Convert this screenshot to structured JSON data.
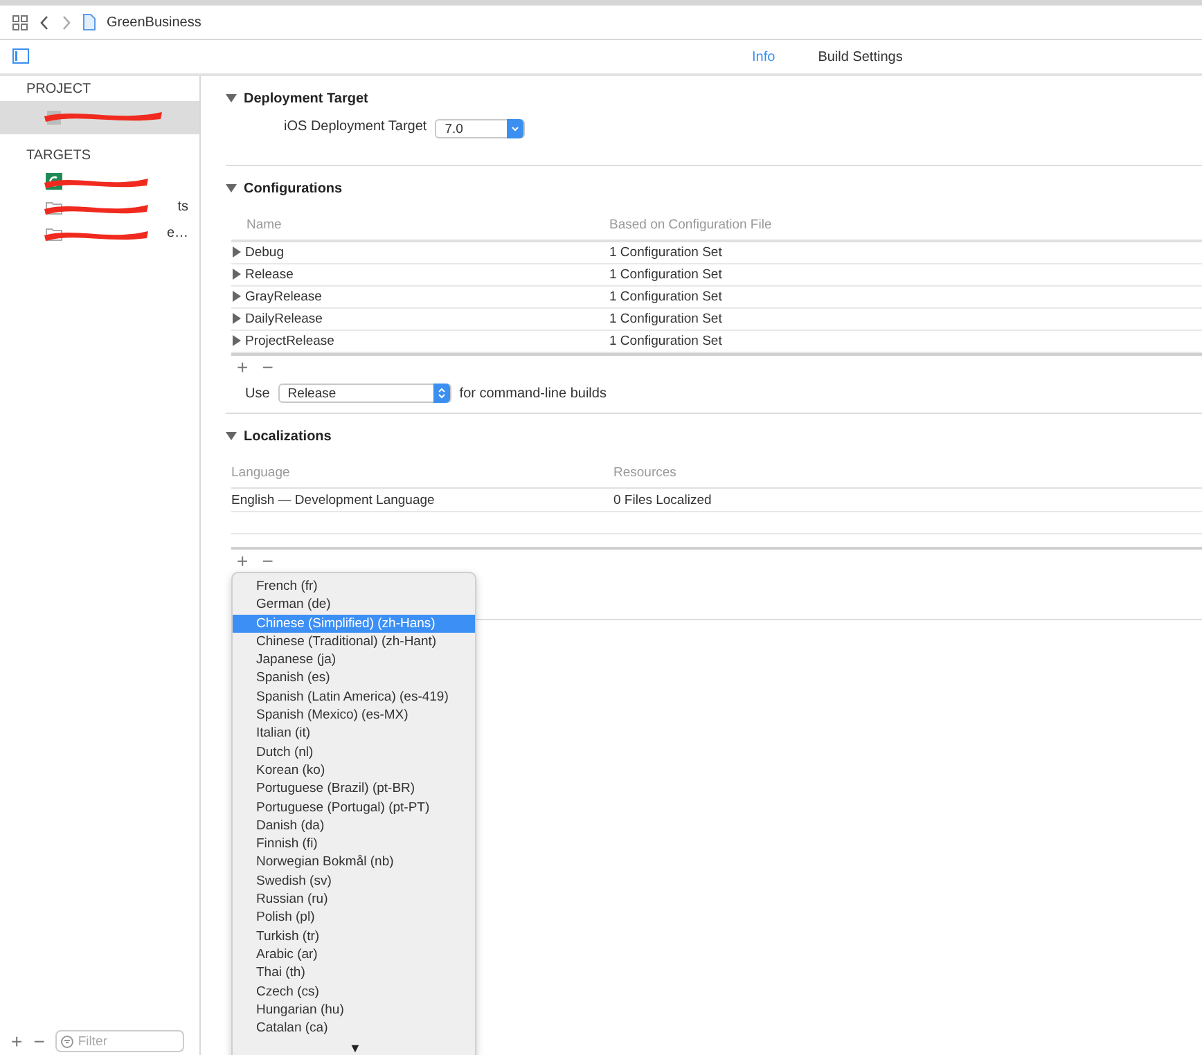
{
  "toolbar": {
    "file_name": "GreenBusiness"
  },
  "tabs": [
    {
      "label": "Info",
      "selected": true
    },
    {
      "label": "Build Settings",
      "selected": false
    }
  ],
  "sidebar": {
    "sections": [
      {
        "title": "PROJECT",
        "items": [
          {
            "kind": "project",
            "selected": true
          }
        ]
      },
      {
        "title": "TARGETS",
        "items": [
          {
            "kind": "app",
            "selected": false
          },
          {
            "kind": "folder",
            "label": "ts",
            "selected": false
          },
          {
            "kind": "folder",
            "label": "e…",
            "selected": false
          }
        ]
      }
    ],
    "controls": [
      "+",
      "−"
    ],
    "filter_placeholder": "Filter"
  },
  "deployment": {
    "title": "Deployment Target",
    "expanded": true,
    "label": "iOS Deployment Target",
    "value": "7.0"
  },
  "configurations": {
    "title": "Configurations",
    "expanded": true,
    "columns": [
      "Name",
      "Based on Configuration File"
    ],
    "rows": [
      {
        "name": "Debug",
        "file": "1 Configuration Set"
      },
      {
        "name": "Release",
        "file": "1 Configuration Set"
      },
      {
        "name": "GrayRelease",
        "file": "1 Configuration Set"
      },
      {
        "name": "DailyRelease",
        "file": "1 Configuration Set"
      },
      {
        "name": "ProjectRelease",
        "file": "1 Configuration Set"
      }
    ],
    "controls": [
      "+",
      "−"
    ],
    "use_label": "Use",
    "use_value": "Release",
    "use_suffix": "for command-line builds"
  },
  "localizations": {
    "title": "Localizations",
    "expanded": true,
    "columns": [
      "Language",
      "Resources"
    ],
    "rows": [
      {
        "language": "English — Development Language",
        "resources": "0 Files Localized"
      }
    ],
    "controls": [
      "+",
      "−"
    ]
  },
  "language_menu": {
    "items": [
      {
        "label": "French (fr)",
        "selected": false
      },
      {
        "label": "German (de)",
        "selected": false
      },
      {
        "label": "Chinese (Simplified) (zh-Hans)",
        "selected": true
      },
      {
        "label": "Chinese (Traditional) (zh-Hant)",
        "selected": false
      },
      {
        "label": "Japanese (ja)",
        "selected": false
      },
      {
        "label": "Spanish (es)",
        "selected": false
      },
      {
        "label": "Spanish (Latin America) (es-419)",
        "selected": false
      },
      {
        "label": "Spanish (Mexico) (es-MX)",
        "selected": false
      },
      {
        "label": "Italian (it)",
        "selected": false
      },
      {
        "label": "Dutch (nl)",
        "selected": false
      },
      {
        "label": "Korean (ko)",
        "selected": false
      },
      {
        "label": "Portuguese (Brazil) (pt-BR)",
        "selected": false
      },
      {
        "label": "Portuguese (Portugal) (pt-PT)",
        "selected": false
      },
      {
        "label": "Danish (da)",
        "selected": false
      },
      {
        "label": "Finnish (fi)",
        "selected": false
      },
      {
        "label": "Norwegian Bokmål (nb)",
        "selected": false
      },
      {
        "label": "Swedish (sv)",
        "selected": false
      },
      {
        "label": "Russian (ru)",
        "selected": false
      },
      {
        "label": "Polish (pl)",
        "selected": false
      },
      {
        "label": "Turkish (tr)",
        "selected": false
      },
      {
        "label": "Arabic (ar)",
        "selected": false
      },
      {
        "label": "Thai (th)",
        "selected": false
      },
      {
        "label": "Czech (cs)",
        "selected": false
      },
      {
        "label": "Hungarian (hu)",
        "selected": false
      },
      {
        "label": "Catalan (ca)",
        "selected": false
      }
    ],
    "scroll_arrow": "▼"
  }
}
